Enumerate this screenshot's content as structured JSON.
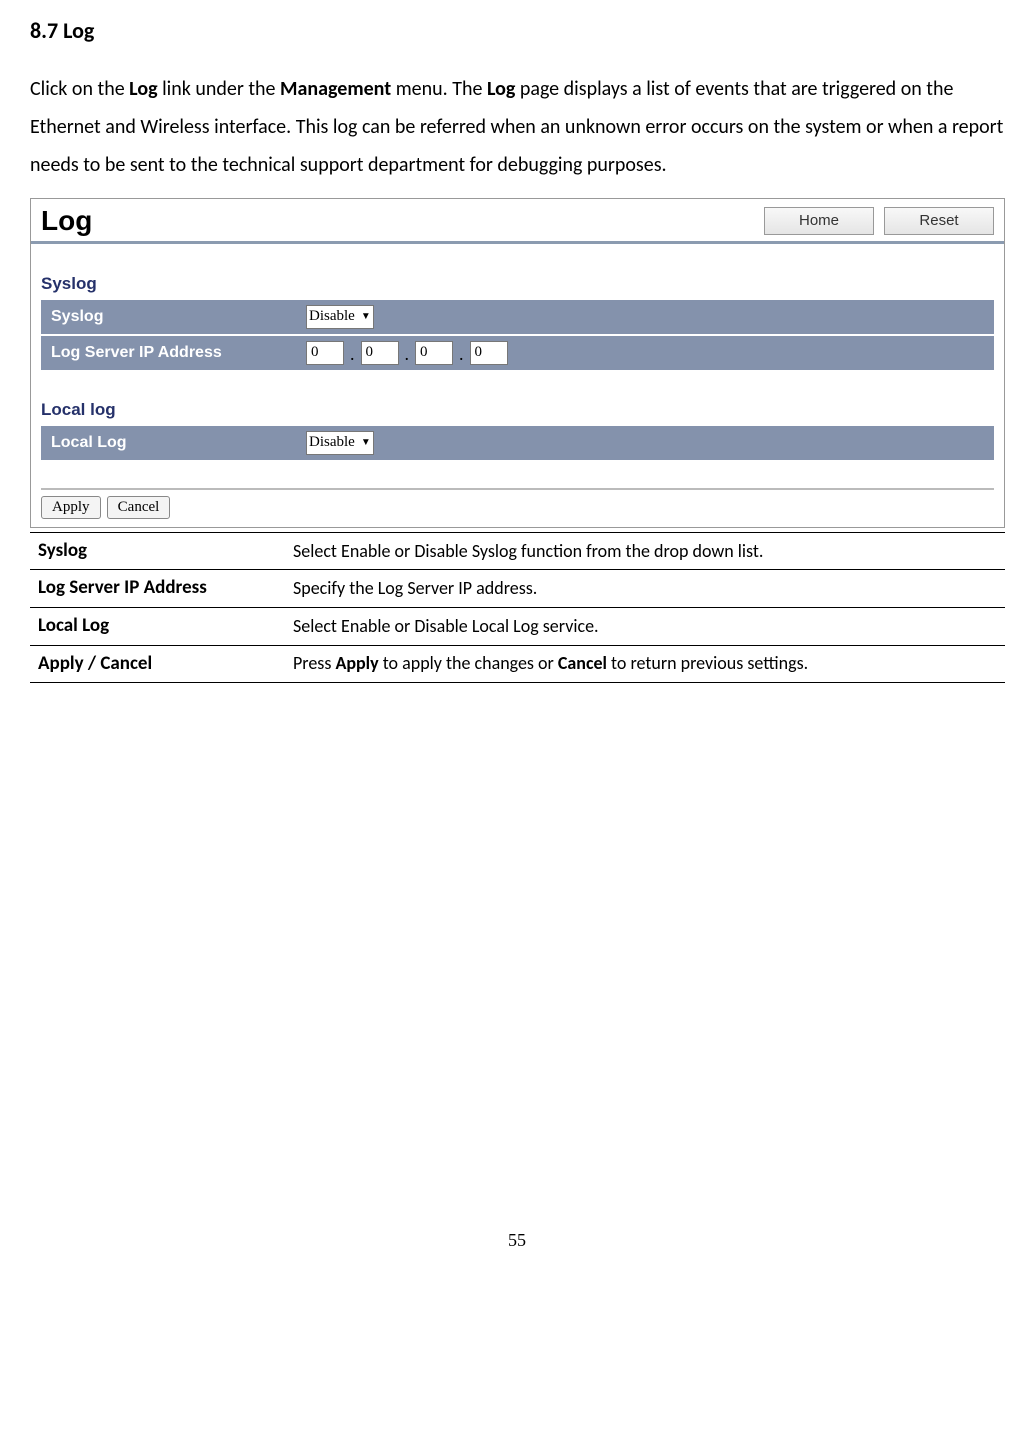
{
  "heading": "8.7 Log",
  "intro": {
    "t1": "Click on the ",
    "b1": "Log",
    "t2": " link under the ",
    "b2": "Management",
    "t3": " menu. The ",
    "b3": "Log",
    "t4": " page displays a list of events that are triggered on the Ethernet and Wireless interface. This log can be referred when an unknown error occurs on the system or when a report needs to be sent to the technical support department for debugging purposes."
  },
  "screenshot": {
    "title": "Log",
    "home_btn": "Home",
    "reset_btn": "Reset",
    "syslog_group": "Syslog",
    "syslog_row_label": "Syslog",
    "syslog_select": "Disable",
    "logip_row_label": "Log Server IP Address",
    "ip_octets": [
      "0",
      "0",
      "0",
      "0"
    ],
    "locallog_group": "Local log",
    "locallog_row_label": "Local Log",
    "locallog_select": "Disable",
    "apply_btn": "Apply",
    "cancel_btn": "Cancel"
  },
  "desc_rows": [
    {
      "label": "Syslog",
      "desc_plain": "Select Enable or Disable Syslog function from the drop down list."
    },
    {
      "label": "Log Server IP Address",
      "desc_plain": "Specify the Log Server IP address."
    },
    {
      "label": "Local Log",
      "desc_plain": "Select Enable or Disable Local Log service."
    }
  ],
  "desc_apply_row": {
    "label": "Apply / Cancel",
    "t1": "Press ",
    "b1": "Apply",
    "t2": " to apply the changes or ",
    "b2": "Cancel",
    "t3": " to return previous settings."
  },
  "page_number": "55"
}
